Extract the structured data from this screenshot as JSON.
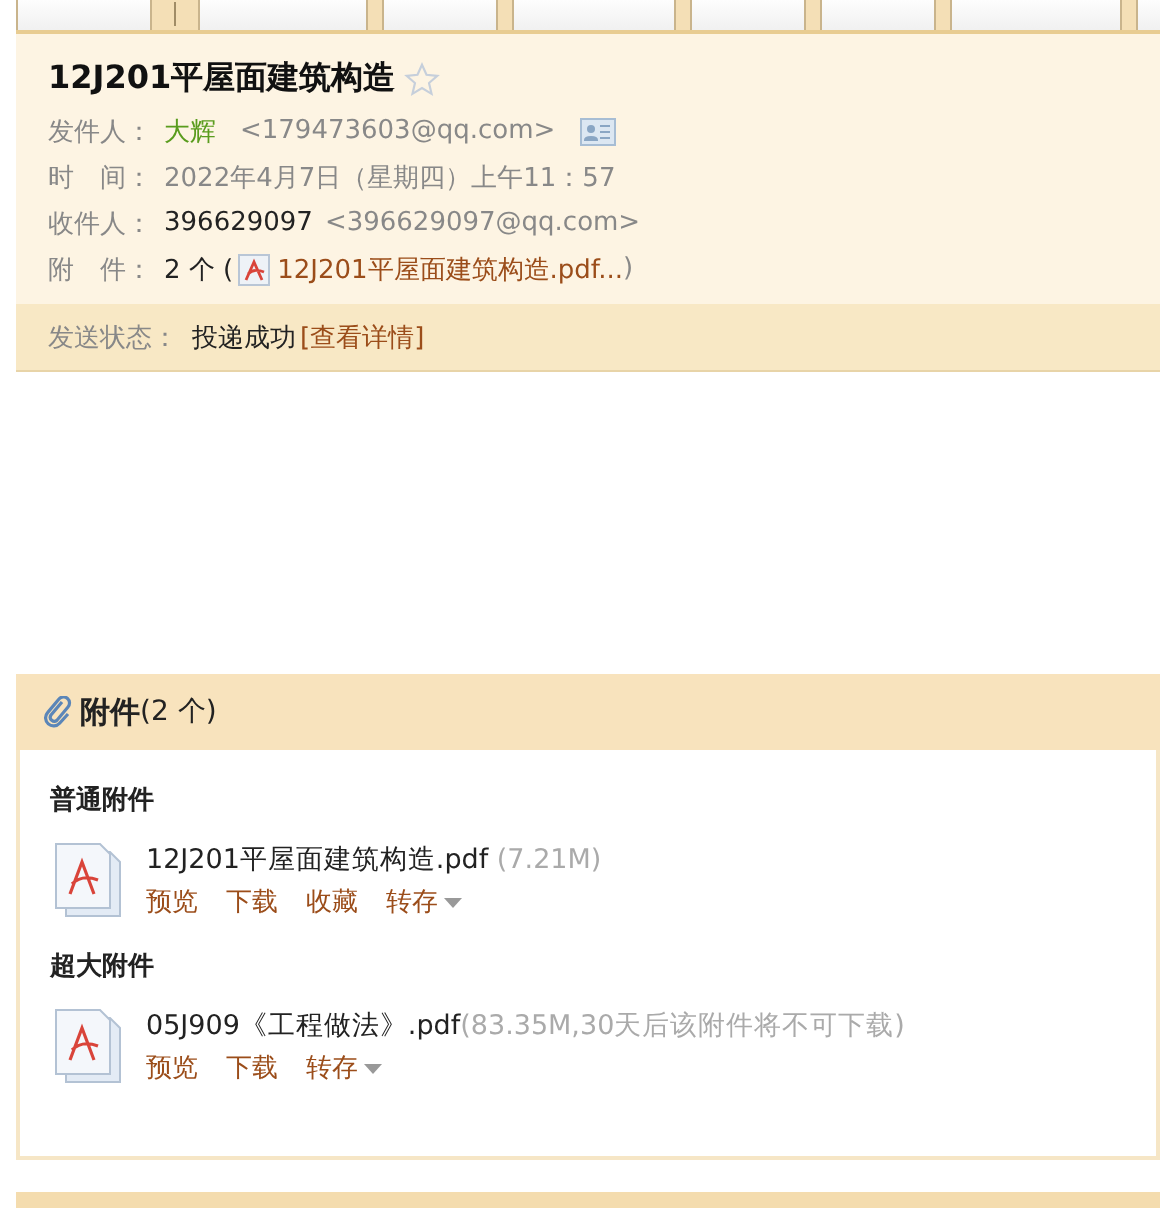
{
  "toolbar": {
    "items": [
      {
        "kind": "button"
      },
      {
        "kind": "separator"
      },
      {
        "kind": "button"
      },
      {
        "kind": "button"
      },
      {
        "kind": "button"
      },
      {
        "kind": "button"
      },
      {
        "kind": "button"
      },
      {
        "kind": "button"
      },
      {
        "kind": "button"
      }
    ]
  },
  "mail": {
    "subject": "12J201平屋面建筑构造",
    "starred": false,
    "from": {
      "label": "发件人：",
      "name": "大辉",
      "address": "<179473603@qq.com>"
    },
    "time": {
      "label": "时　间：",
      "value": "2022年4月7日（星期四）上午11：57"
    },
    "to": {
      "label": "收件人：",
      "name": "396629097",
      "address": "<396629097@qq.com>"
    },
    "attachments": {
      "label": "附　件：",
      "count": "2 个 (",
      "file": "12J201平屋面建筑构造.pdf...",
      "close": ")"
    },
    "status": {
      "label": "发送状态：",
      "value": "投递成功",
      "link": "[查看详情]"
    }
  },
  "attachment_panel": {
    "title": "附件",
    "count": "(2 个)",
    "groups": [
      {
        "title": "普通附件",
        "files": [
          {
            "name": "12J201平屋面建筑构造.pdf",
            "info": " (7.21M)",
            "actions": [
              "预览",
              "下载",
              "收藏",
              "转存"
            ]
          }
        ]
      },
      {
        "title": "超大附件",
        "files": [
          {
            "name": "05J909《工程做法》.pdf",
            "info": "(83.35M,30天后该附件将不可下载)",
            "actions": [
              "预览",
              "下载",
              "转存"
            ]
          }
        ]
      }
    ]
  }
}
